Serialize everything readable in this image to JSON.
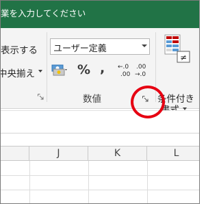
{
  "titlebar": {
    "tell_me": "業を入力してください"
  },
  "alignment": {
    "wrap_text_label": "表示する",
    "merge_center_label": "中央揃え"
  },
  "number": {
    "format_value": "ユーザー定義",
    "percent_label": "%",
    "comma_label": ",",
    "increase_decimal_top": "←.0",
    "increase_decimal_bottom": ".00",
    "decrease_decimal_top": ".00",
    "decrease_decimal_bottom": "→.0",
    "group_label": "数値"
  },
  "styles": {
    "conditional_format_line1": "条件付き",
    "conditional_format_line2": "書式"
  },
  "grid": {
    "columns": [
      "J",
      "K",
      "L"
    ]
  },
  "colors": {
    "title_bar": "#217346",
    "highlight_ring": "#e60012"
  }
}
